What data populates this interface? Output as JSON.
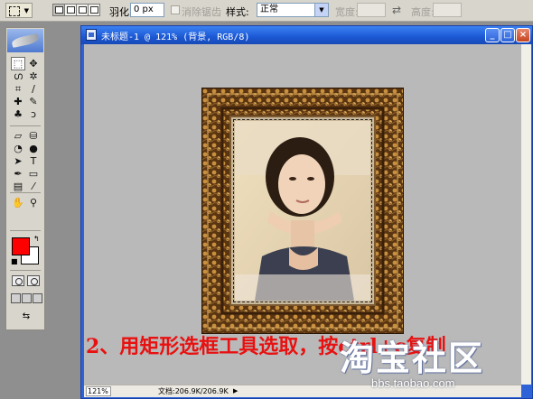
{
  "options_bar": {
    "feather_label": "羽化:",
    "feather_value": "0 px",
    "antialias_label": "消除锯齿",
    "style_label": "样式:",
    "style_value": "正常",
    "width_label": "宽度:",
    "height_label": "高度:",
    "swap_glyph": "⇄"
  },
  "document": {
    "title": "未标题-1 @ 121% (背景, RGB/8)",
    "zoom": "121%",
    "doc_size": "文档:206.9K/206.9K",
    "scroll_arrow": "▶"
  },
  "window_buttons": {
    "minimize": "_",
    "maximize": "□",
    "close": "×"
  },
  "toolbox": {
    "tools": [
      {
        "name": "marquee-tool",
        "glyph": "⬚",
        "active": true
      },
      {
        "name": "move-tool",
        "glyph": "✥"
      },
      {
        "name": "lasso-tool",
        "glyph": "ഗ"
      },
      {
        "name": "magic-wand-tool",
        "glyph": "✲"
      },
      {
        "name": "crop-tool",
        "glyph": "⌗"
      },
      {
        "name": "slice-tool",
        "glyph": "∕"
      },
      {
        "name": "healing-brush-tool",
        "glyph": "✚"
      },
      {
        "name": "brush-tool",
        "glyph": "✎"
      },
      {
        "name": "clone-stamp-tool",
        "glyph": "♣"
      },
      {
        "name": "history-brush-tool",
        "glyph": "ↄ"
      },
      {
        "name": "eraser-tool",
        "glyph": "▱"
      },
      {
        "name": "paint-bucket-tool",
        "glyph": "⛁"
      },
      {
        "name": "blur-tool",
        "glyph": "◔"
      },
      {
        "name": "dodge-tool",
        "glyph": "●"
      },
      {
        "name": "path-selection-tool",
        "glyph": "➤"
      },
      {
        "name": "type-tool",
        "glyph": "T"
      },
      {
        "name": "pen-tool",
        "glyph": "✒"
      },
      {
        "name": "shape-tool",
        "glyph": "▭"
      },
      {
        "name": "notes-tool",
        "glyph": "▤"
      },
      {
        "name": "eyedropper-tool",
        "glyph": "⁄"
      },
      {
        "name": "hand-tool",
        "glyph": "✋"
      },
      {
        "name": "zoom-tool",
        "glyph": "⚲"
      }
    ],
    "foreground_color": "#ff0000",
    "background_color": "#ffffff",
    "jump_glyph": "⇆"
  },
  "caption": "2、用矩形选框工具选取，按ctrl+c复制",
  "watermark": {
    "text": "淘宝社区",
    "url": "bbs.taobao.com"
  },
  "colors": {
    "caption": "#e81111",
    "titlebar": "#1b58d4",
    "workspace": "#b9b9b9"
  }
}
